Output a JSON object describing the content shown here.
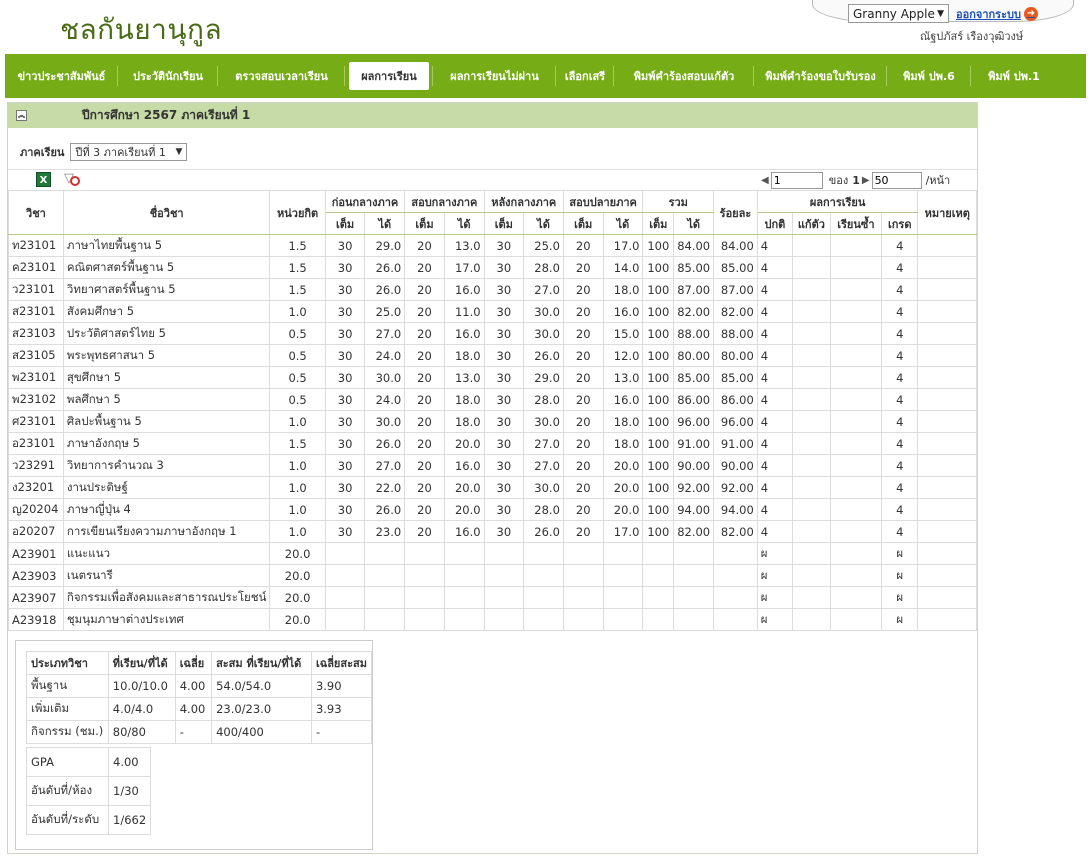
{
  "header": {
    "logo_text": "ชลกันยานุกูล",
    "user_select_value": "Granny Apple",
    "logout_label": "ออกจากระบบ",
    "user_name": "ณัฐปภัสร์ เรืองวุฒิวงษ์"
  },
  "nav": {
    "items": [
      {
        "label": "ข่าวประชาสัมพันธ์"
      },
      {
        "label": "ประวัตินักเรียน"
      },
      {
        "label": "ตรวจสอบเวลาเรียน"
      },
      {
        "label": "ผลการเรียน"
      },
      {
        "label": "ผลการเรียนไม่ผ่าน"
      },
      {
        "label": "เลือกเสรี"
      },
      {
        "label": "พิมพ์คำร้องสอบแก้ตัว"
      },
      {
        "label": "พิมพ์คำร้องขอใบรับรอง"
      },
      {
        "label": "พิมพ์ ปพ.6"
      },
      {
        "label": "พิมพ์ ปพ.1"
      }
    ],
    "active_index": 3
  },
  "panel": {
    "title": "ปีการศึกษา 2567 ภาคเรียนที่ 1",
    "semester_label": "ภาคเรียน",
    "semester_value": "ปีที่ 3 ภาคเรียนที่ 1"
  },
  "pager": {
    "page_value": "1",
    "of_label": "ของ",
    "total_pages": "1",
    "per_page_value": "50",
    "per_page_label": "/หน้า"
  },
  "table": {
    "headers": {
      "code": "วิชา",
      "name": "ชื่อวิชา",
      "credit": "หน่วยกิต",
      "pre_mid": "ก่อนกลางภาค",
      "mid": "สอบกลางภาค",
      "post_mid": "หลังกลางภาค",
      "final": "สอบปลายภาค",
      "total": "รวม",
      "percent": "ร้อยละ",
      "result": "ผลการเรียน",
      "remark": "หมายเหตุ",
      "full": "เต็ม",
      "got": "ได้",
      "normal": "ปกติ",
      "retest": "แก้ตัว",
      "repeat": "เรียนซ้ำ",
      "grade": "เกรด"
    },
    "rows": [
      [
        "ท23101",
        "ภาษาไทยพื้นฐาน 5",
        "1.5",
        "30",
        "29.0",
        "20",
        "13.0",
        "30",
        "25.0",
        "20",
        "17.0",
        "100",
        "84.00",
        "84.00",
        "4",
        "",
        "",
        "4",
        ""
      ],
      [
        "ค23101",
        "คณิตศาสตร์พื้นฐาน 5",
        "1.5",
        "30",
        "26.0",
        "20",
        "17.0",
        "30",
        "28.0",
        "20",
        "14.0",
        "100",
        "85.00",
        "85.00",
        "4",
        "",
        "",
        "4",
        ""
      ],
      [
        "ว23101",
        "วิทยาศาสตร์พื้นฐาน 5",
        "1.5",
        "30",
        "26.0",
        "20",
        "16.0",
        "30",
        "27.0",
        "20",
        "18.0",
        "100",
        "87.00",
        "87.00",
        "4",
        "",
        "",
        "4",
        ""
      ],
      [
        "ส23101",
        "สังคมศึกษา 5",
        "1.0",
        "30",
        "25.0",
        "20",
        "11.0",
        "30",
        "30.0",
        "20",
        "16.0",
        "100",
        "82.00",
        "82.00",
        "4",
        "",
        "",
        "4",
        ""
      ],
      [
        "ส23103",
        "ประวัติศาสตร์ไทย 5",
        "0.5",
        "30",
        "27.0",
        "20",
        "16.0",
        "30",
        "30.0",
        "20",
        "15.0",
        "100",
        "88.00",
        "88.00",
        "4",
        "",
        "",
        "4",
        ""
      ],
      [
        "ส23105",
        "พระพุทธศาสนา 5",
        "0.5",
        "30",
        "24.0",
        "20",
        "18.0",
        "30",
        "26.0",
        "20",
        "12.0",
        "100",
        "80.00",
        "80.00",
        "4",
        "",
        "",
        "4",
        ""
      ],
      [
        "พ23101",
        "สุขศึกษา 5",
        "0.5",
        "30",
        "30.0",
        "20",
        "13.0",
        "30",
        "29.0",
        "20",
        "13.0",
        "100",
        "85.00",
        "85.00",
        "4",
        "",
        "",
        "4",
        ""
      ],
      [
        "พ23102",
        "พลศึกษา 5",
        "0.5",
        "30",
        "24.0",
        "20",
        "18.0",
        "30",
        "28.0",
        "20",
        "16.0",
        "100",
        "86.00",
        "86.00",
        "4",
        "",
        "",
        "4",
        ""
      ],
      [
        "ศ23101",
        "ศิลปะพื้นฐาน 5",
        "1.0",
        "30",
        "30.0",
        "20",
        "18.0",
        "30",
        "30.0",
        "20",
        "18.0",
        "100",
        "96.00",
        "96.00",
        "4",
        "",
        "",
        "4",
        ""
      ],
      [
        "อ23101",
        "ภาษาอังกฤษ 5",
        "1.5",
        "30",
        "26.0",
        "20",
        "20.0",
        "30",
        "27.0",
        "20",
        "18.0",
        "100",
        "91.00",
        "91.00",
        "4",
        "",
        "",
        "4",
        ""
      ],
      [
        "ว23291",
        "วิทยาการคำนวณ 3",
        "1.0",
        "30",
        "27.0",
        "20",
        "16.0",
        "30",
        "27.0",
        "20",
        "20.0",
        "100",
        "90.00",
        "90.00",
        "4",
        "",
        "",
        "4",
        ""
      ],
      [
        "ง23201",
        "งานประดิษฐ์",
        "1.0",
        "30",
        "22.0",
        "20",
        "20.0",
        "30",
        "30.0",
        "20",
        "20.0",
        "100",
        "92.00",
        "92.00",
        "4",
        "",
        "",
        "4",
        ""
      ],
      [
        "ญ20204",
        "ภาษาญี่ปุ่น 4",
        "1.0",
        "30",
        "26.0",
        "20",
        "20.0",
        "30",
        "28.0",
        "20",
        "20.0",
        "100",
        "94.00",
        "94.00",
        "4",
        "",
        "",
        "4",
        ""
      ],
      [
        "อ20207",
        "การเขียนเรียงความภาษาอังกฤษ 1",
        "1.0",
        "30",
        "23.0",
        "20",
        "16.0",
        "30",
        "26.0",
        "20",
        "17.0",
        "100",
        "82.00",
        "82.00",
        "4",
        "",
        "",
        "4",
        ""
      ],
      [
        "A23901",
        "แนะแนว",
        "20.0",
        "",
        "",
        "",
        "",
        "",
        "",
        "",
        "",
        "",
        "",
        "",
        "ผ",
        "",
        "",
        "ผ",
        ""
      ],
      [
        "A23903",
        "เนตรนารี",
        "20.0",
        "",
        "",
        "",
        "",
        "",
        "",
        "",
        "",
        "",
        "",
        "",
        "ผ",
        "",
        "",
        "ผ",
        ""
      ],
      [
        "A23907",
        "กิจกรรมเพื่อสังคมและสาธารณประโยชน์",
        "20.0",
        "",
        "",
        "",
        "",
        "",
        "",
        "",
        "",
        "",
        "",
        "",
        "ผ",
        "",
        "",
        "ผ",
        ""
      ],
      [
        "A23918",
        "ชุมนุมภาษาต่างประเทศ",
        "20.0",
        "",
        "",
        "",
        "",
        "",
        "",
        "",
        "",
        "",
        "",
        "",
        "ผ",
        "",
        "",
        "ผ",
        ""
      ]
    ]
  },
  "summary": {
    "headers": [
      "ประเภทวิชา",
      "ที่เรียน/ที่ได้",
      "เฉลี่ย",
      "สะสม ที่เรียน/ที่ได้",
      "เฉลี่ยสะสม"
    ],
    "rows": [
      [
        "พื้นฐาน",
        "10.0/10.0",
        "4.00",
        "54.0/54.0",
        "3.90"
      ],
      [
        "เพิ่มเติม",
        "4.0/4.0",
        "4.00",
        "23.0/23.0",
        "3.93"
      ],
      [
        "กิจกรรม (ชม.)",
        "80/80",
        "-",
        "400/400",
        "-"
      ]
    ],
    "gpa": [
      {
        "label": "GPA",
        "value": "4.00"
      },
      {
        "label": "อันดับที่/ห้อง",
        "value": "1/30"
      },
      {
        "label": "อันดับที่/ระดับ",
        "value": "1/662"
      }
    ]
  },
  "colors": {
    "nav_bg": "#76ac16",
    "panel_header_bg": "#c7dba6",
    "logo": "#4a6b16",
    "logout_link": "#1c4fb8"
  },
  "icons": {
    "collapse": "collapse-up-icon",
    "excel": "excel-export-icon",
    "filter": "filter-clear-icon",
    "logout": "logout-arrow-icon"
  }
}
